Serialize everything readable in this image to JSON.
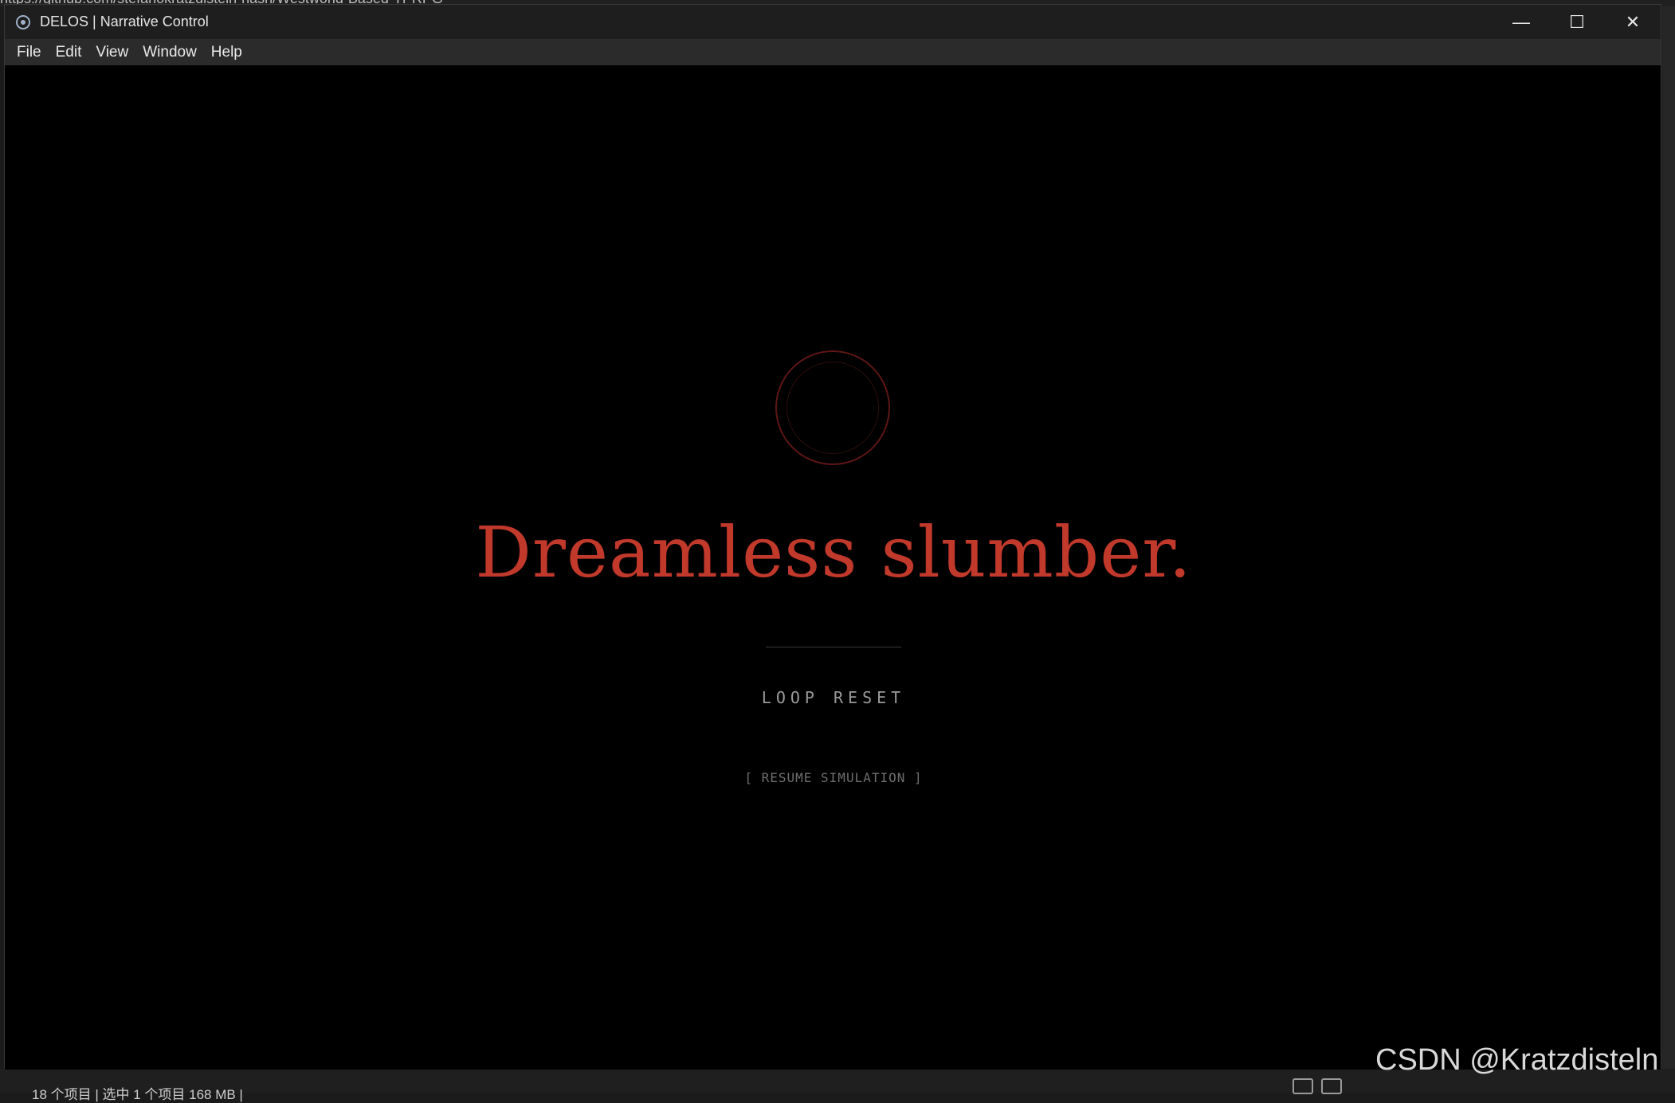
{
  "background": {
    "top_url": "https://github.com/stefanokratzdistein-hash/Westworld-Based-TPRPG",
    "status_text": "18 个项目  |  选中 1 个项目  168 MB  |"
  },
  "window": {
    "title": "DELOS | Narrative Control",
    "controls": {
      "minimize": "—",
      "maximize": "☐",
      "close": "✕"
    }
  },
  "menu": [
    "File",
    "Edit",
    "View",
    "Window",
    "Help"
  ],
  "main": {
    "headline": "Dreamless slumber.",
    "loop_label": "LOOP RESET",
    "resume_label": "[ RESUME SIMULATION ]"
  },
  "watermark": "CSDN @Kratzdisteln",
  "colors": {
    "accent": "#c0392b",
    "ring": "#5e1616",
    "background": "#000000"
  }
}
